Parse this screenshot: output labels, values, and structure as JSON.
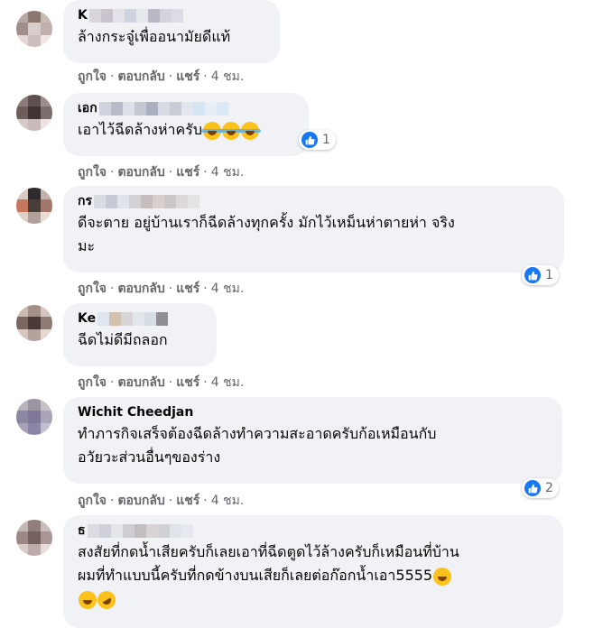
{
  "comments": [
    {
      "author": "K",
      "text": "ล้างกระจู๋เพื่ออนามัยดีแท้",
      "like": "ถูกใจ",
      "reply": "ตอบกลับ",
      "share": "แชร์",
      "time": "4 ชม."
    },
    {
      "author": "เอก",
      "text": "เอาไว้ฉีดล้างห่าครับ",
      "emoji_after": [
        "laughing-crying-emoji",
        "laughing-crying-emoji",
        "laughing-crying-emoji"
      ],
      "reaction_count": "1",
      "like": "ถูกใจ",
      "reply": "ตอบกลับ",
      "share": "แชร์",
      "time": "4 ชม."
    },
    {
      "author": "กร",
      "text": "ดีจะตาย อยู่บ้านเราก็ฉีดล้างทุกครั้ง มักไว้เหม็นห่าตายห่า จริง\nมะ",
      "reaction_count": "1",
      "like": "ถูกใจ",
      "reply": "ตอบกลับ",
      "share": "แชร์",
      "time": "4 ชม."
    },
    {
      "author": "Ke",
      "text": "ฉีดไม่ดีมีถลอก",
      "like": "ถูกใจ",
      "reply": "ตอบกลับ",
      "share": "แชร์",
      "time": "4 ชม."
    },
    {
      "author": "Wichit Cheedjan",
      "text": "ทำภารกิจเสร็จต้องฉีดล้างทำความสะอาดครับก้อเหมือนกับ\nอวัยวะส่วนอื่นๆของร่าง",
      "reaction_count": "2",
      "like": "ถูกใจ",
      "reply": "ตอบกลับ",
      "share": "แชร์",
      "time": "4 ชม."
    },
    {
      "author": "ธ",
      "text": "สงสัยที่กดน้ำเสียครับก็เลยเอาที่ฉีดตูดไว้ล้างครับก็เหมือนที่บ้าน\nผมที่ทำแบบนี้ครับที่กดข้างบนเสียก็เลยต่อก๊อกน้ำเอา5555",
      "emoji_after": [
        "grinning-emoji",
        "grinning-emoji",
        "rofl-emoji"
      ]
    }
  ],
  "colors": {
    "bubble": "#f0f2f5",
    "meta_text": "#65676b",
    "like_blue": "#1877f2"
  }
}
